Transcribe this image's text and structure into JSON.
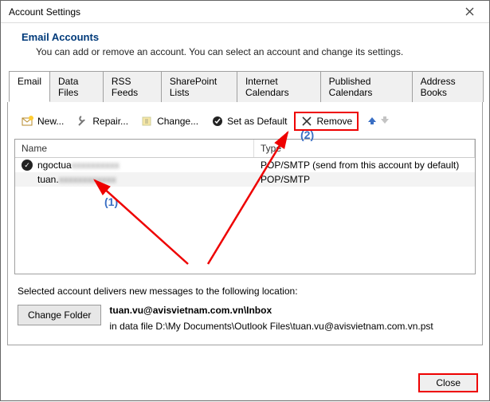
{
  "window": {
    "title": "Account Settings"
  },
  "header": {
    "title": "Email Accounts",
    "subtitle": "You can add or remove an account. You can select an account and change its settings."
  },
  "tabs": [
    {
      "label": "Email",
      "active": true
    },
    {
      "label": "Data Files"
    },
    {
      "label": "RSS Feeds"
    },
    {
      "label": "SharePoint Lists"
    },
    {
      "label": "Internet Calendars"
    },
    {
      "label": "Published Calendars"
    },
    {
      "label": "Address Books"
    }
  ],
  "toolbar": {
    "new_label": "New...",
    "repair_label": "Repair...",
    "change_label": "Change...",
    "default_label": "Set as Default",
    "remove_label": "Remove"
  },
  "list": {
    "col_name": "Name",
    "col_type": "Type",
    "rows": [
      {
        "name_prefix": "ngoctua",
        "type": "POP/SMTP (send from this account by default)",
        "default": true
      },
      {
        "name_prefix": "tuan.",
        "type": "POP/SMTP",
        "default": false
      }
    ]
  },
  "annotations": {
    "one": "(1)",
    "two": "(2)"
  },
  "footer": {
    "line": "Selected account delivers new messages to the following location:",
    "change_folder": "Change Folder",
    "path_bold": "tuan.vu@avisvietnam.com.vn\\Inbox",
    "path_line2": "in data file D:\\My Documents\\Outlook Files\\tuan.vu@avisvietnam.com.vn.pst"
  },
  "close_button": "Close"
}
